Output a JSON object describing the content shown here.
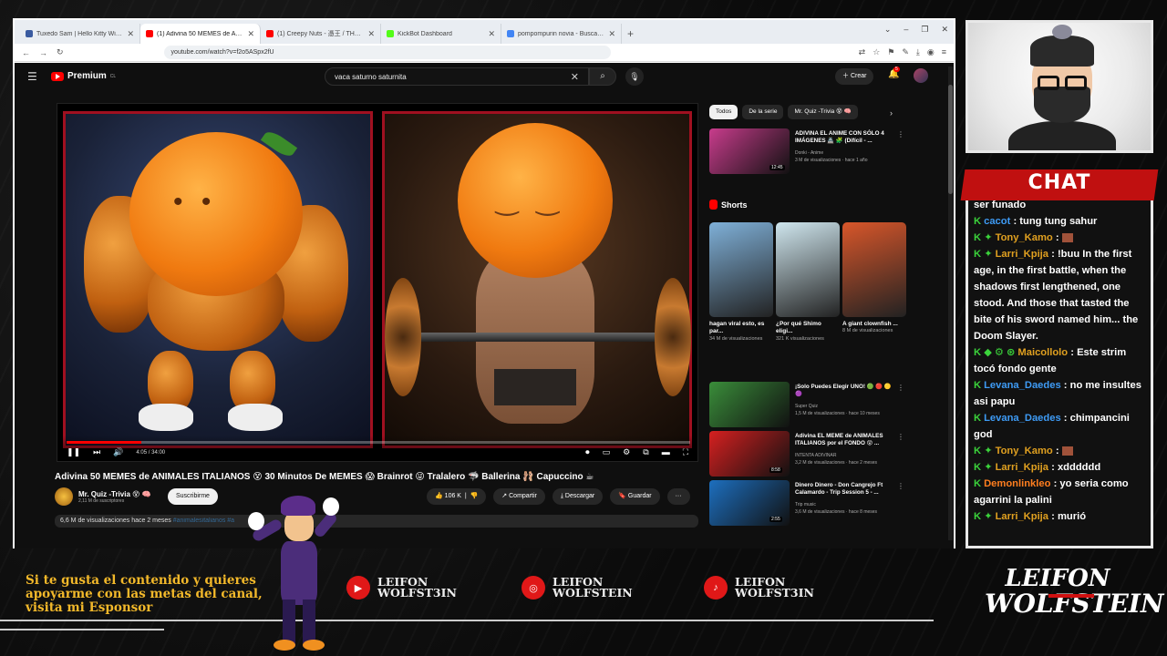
{
  "browser": {
    "tabs": [
      {
        "label": "Tuxedo Sam | Hello Kitty Wiki | Fandom",
        "color": "#3a5ba0",
        "active": false
      },
      {
        "label": "(1) Adivina 50 MEMES de ANIMA...",
        "color": "#ff0000",
        "active": true
      },
      {
        "label": "(1) Creepy Nuts - 憑王 / THE FIRST",
        "color": "#ff0000",
        "active": false
      },
      {
        "label": "KickBot Dashboard",
        "color": "#53fc18",
        "active": false
      },
      {
        "label": "pompompurin novia - Buscar con Google",
        "color": "#4285f4",
        "active": false
      }
    ],
    "url": "youtube.com/watch?v=f2o5ASpx2fU"
  },
  "youtube": {
    "logo_text": "Premium",
    "logo_region": "CL",
    "search_query": "vaca saturno saturnita",
    "create_label": "Crear",
    "notif_count": "5",
    "video": {
      "time": "4:05 / 34:00",
      "progress": 0.12,
      "title": "Adivina 50 MEMES de ANIMALES ITALIANOS 😵 30 Minutos De MEMES 😱 Brainrot 😜 Tralalero 🦈 Ballerina 🩰 Capuccino ☕",
      "channel_name": "Mr. Quiz -Trivia 😵 🧠",
      "channel_subs": "2,11 M de suscriptores",
      "subscribe_label": "Suscribirme",
      "likes": "106 K",
      "share_label": "Compartir",
      "download_label": "Descargar",
      "save_label": "Guardar",
      "views_date": "6,6 M de visualizaciones  hace 2 meses",
      "tags": "#animalesitalianos #a"
    },
    "chips": [
      "Todos",
      "De la serie",
      "Mr. Quiz -Trivia 😵 🧠"
    ],
    "recs_top": [
      {
        "title": "ADIVINA EL ANIME CON SÓLO 4 IMÁGENES 🏯 🧩 (Difícil - ...",
        "channel": "Donki - Anime",
        "meta": "3 M de visualizaciones · hace 1 año",
        "duration": "12:45",
        "color": "#c83c8c"
      }
    ],
    "shorts_title": "Shorts",
    "shorts": [
      {
        "title": "hagan viral esto, es par...",
        "views": "34 M de visualizaciones",
        "color": "#7fb0d8"
      },
      {
        "title": "¿Por qué Shimo eligi...",
        "views": "321 K visualizaciones",
        "color": "#cfe6ee"
      },
      {
        "title": "A giant clownfish ...",
        "views": "8 M de visualizaciones",
        "color": "#d8562a"
      }
    ],
    "recs_bottom": [
      {
        "title": "¡Solo Puedes Elegir UNO! 🟢 🔴 🟡 🟣",
        "channel": "Super Quiz",
        "meta": "1,5 M de visualizaciones · hace 10 meses",
        "duration": "",
        "color": "#3a8d3a"
      },
      {
        "title": "Adivina EL MEME de ANIMALES ITALIANOS por el FONDO 😵 ...",
        "channel": "INTENTA ADIVINAR",
        "meta": "3,2 M de visualizaciones · hace 2 meses",
        "duration": "8:58",
        "color": "#d62020"
      },
      {
        "title": "Dinero Dinero - Don Cangrejo Ft Calamardo - Trip Session 5 - ...",
        "channel": "Trip music",
        "meta": "3,6 M de visualizaciones · hace 8 meses",
        "duration": "2:55",
        "color": "#1d6fbf"
      }
    ]
  },
  "chat": {
    "title": "CHAT",
    "messages": [
      {
        "user": "",
        "text": "ser funado",
        "badges": "",
        "color": "blue"
      },
      {
        "user": "cacot",
        "text": ": tung tung sahur",
        "badges": "K",
        "color": "blue"
      },
      {
        "user": "Tony_Kamo",
        "text": ":",
        "badges": "K ✦",
        "color": "gold",
        "emote": true
      },
      {
        "user": "Larri_Kpija",
        "text": ": !buu In the first age, in the first battle, when the shadows first lengthened, one stood. And those that tasted the bite of his sword named him... the Doom Slayer.",
        "badges": "K ✦",
        "color": "gold"
      },
      {
        "user": "Maicollolo",
        "text": ": Este strim tocó fondo gente",
        "badges": "K ◆ ⚙ ⊛",
        "color": "gold"
      },
      {
        "user": "Levana_Daedes",
        "text": ": no me insultes asi papu",
        "badges": "K",
        "color": "blue"
      },
      {
        "user": "Levana_Daedes",
        "text": ": chimpancini god",
        "badges": "K",
        "color": "blue"
      },
      {
        "user": "Tony_Kamo",
        "text": ":",
        "badges": "K ✦",
        "color": "gold",
        "emote": true
      },
      {
        "user": "Larri_Kpija",
        "text": ": xdddddd",
        "badges": "K ✦",
        "color": "gold"
      },
      {
        "user": "Demonlinkleo",
        "text": ": yo seria como agarrini la palini",
        "badges": "K",
        "color": "orange"
      },
      {
        "user": "Larri_Kpija",
        "text": ": murió",
        "badges": "K ✦",
        "color": "gold"
      }
    ]
  },
  "overlay": {
    "sponsor_text": "Si te gusta el contenido y quieres apoyarme con las metas del canal, visita mi Esponsor",
    "socials": [
      {
        "platform": "youtube-icon",
        "name_line1": "LEIFON",
        "name_line2": "WOLFST3IN"
      },
      {
        "platform": "instagram-icon",
        "name_line1": "LEIFON",
        "name_line2": "WOLFSTEIN"
      },
      {
        "platform": "tiktok-icon",
        "name_line1": "LEIFON",
        "name_line2": "WOLFST3IN"
      }
    ],
    "brand_line1": "LEIFON",
    "brand_line2": "WOLFSTEIN"
  },
  "colors": {
    "youtube_red": "#ff0000",
    "chat_red": "#c01010",
    "sponsor_gold": "#f2b82a",
    "chat_green": "#3bd33b"
  }
}
